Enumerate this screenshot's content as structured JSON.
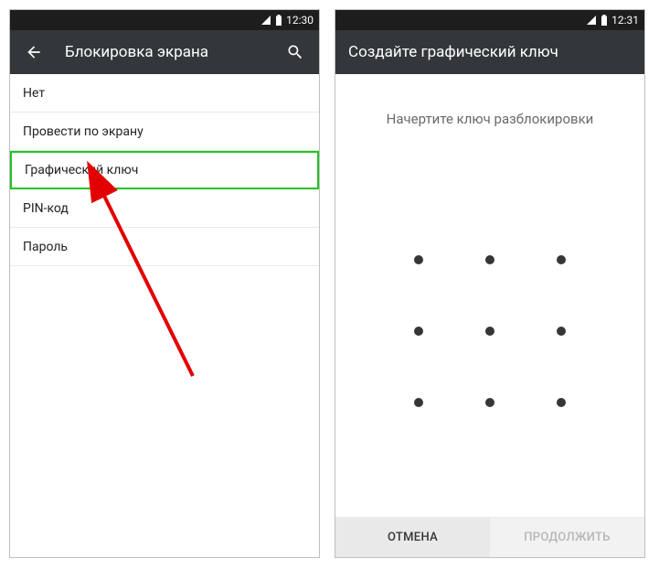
{
  "left": {
    "status": {
      "time": "12:30"
    },
    "appbar": {
      "title": "Блокировка экрана"
    },
    "options": [
      {
        "label": "Нет"
      },
      {
        "label": "Провести по экрану"
      },
      {
        "label": "Графический ключ",
        "highlighted": true
      },
      {
        "label": "PIN-код"
      },
      {
        "label": "Пароль"
      }
    ]
  },
  "right": {
    "status": {
      "time": "12:31"
    },
    "appbar": {
      "title": "Создайте графический ключ"
    },
    "instruction": "Начертите ключ разблокировки",
    "buttons": {
      "cancel": "ОТМЕНА",
      "continue": "ПРОДОЛЖИТЬ"
    }
  }
}
